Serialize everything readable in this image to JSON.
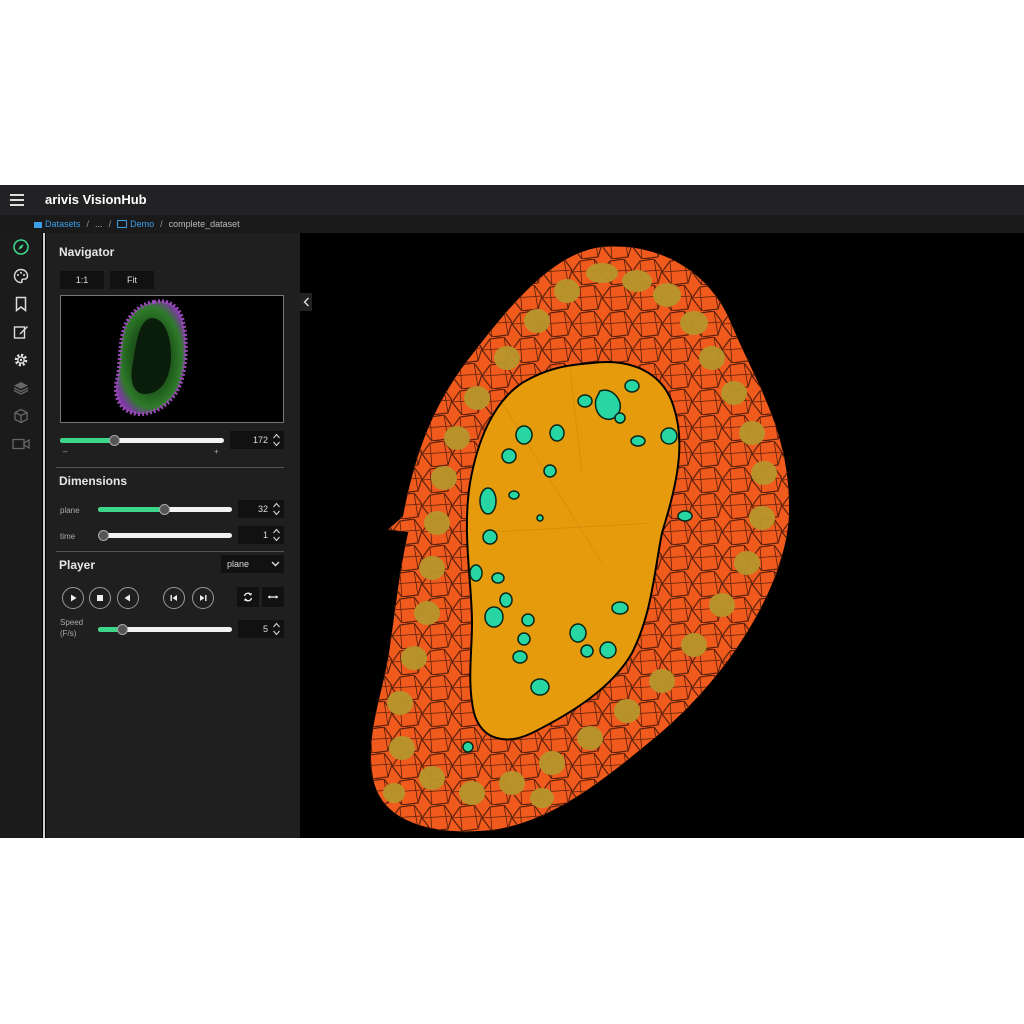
{
  "app": {
    "title": "arivis VisionHub"
  },
  "breadcrumb": {
    "items": [
      "Datasets",
      "...",
      "Demo",
      "complete_dataset"
    ]
  },
  "rail": {
    "icons": [
      "compass-icon",
      "palette-icon",
      "bookmark-icon",
      "edit-icon",
      "settings-icon",
      "layers-icon",
      "cube-icon",
      "video-icon"
    ]
  },
  "navigator": {
    "title": "Navigator",
    "btn_1to1": "1:1",
    "btn_fit": "Fit",
    "zoom_value": "172",
    "zoom_fraction": 0.33,
    "zoom_minus": "–",
    "zoom_plus": "+"
  },
  "dimensions": {
    "title": "Dimensions",
    "plane_label": "plane",
    "plane_value": "32",
    "plane_fraction": 0.49,
    "time_label": "time",
    "time_value": "1",
    "time_fraction": 0.0
  },
  "player": {
    "title": "Player",
    "mode": "plane",
    "speed_label_1": "Speed",
    "speed_label_2": "(F/s)",
    "speed_value": "5",
    "speed_fraction": 0.18
  },
  "colors": {
    "accent": "#3cd58a",
    "link": "#3aa0e8",
    "outer_tissue": "#f05a1c",
    "inner_cells": "#b89a2a",
    "lumen": "#e59b0c",
    "objects": "#28d6a4"
  }
}
